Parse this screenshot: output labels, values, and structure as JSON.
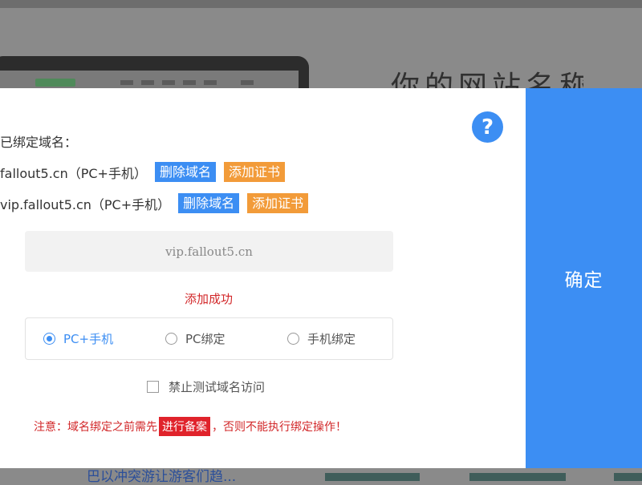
{
  "background_page": {
    "heading": "你的网站名称",
    "bottom_text": "巴以冲突游让游客们趋..."
  },
  "dialog": {
    "help_icon": "?",
    "bound_title": "已绑定域名：",
    "domains": [
      {
        "name": "fallout5.cn（PC+手机）",
        "delete_label": "删除域名",
        "cert_label": "添加证书"
      },
      {
        "name": "vip.fallout5.cn（PC+手机）",
        "delete_label": "删除域名",
        "cert_label": "添加证书"
      }
    ],
    "domain_input": {
      "value": "vip.fallout5.cn"
    },
    "success_message": "添加成功",
    "radios": [
      {
        "label": "PC+手机",
        "checked": true
      },
      {
        "label": "PC绑定",
        "checked": false
      },
      {
        "label": "手机绑定",
        "checked": false
      }
    ],
    "checkbox_label": "禁止测试域名访问",
    "notice": {
      "before": "注意：域名绑定之前需先",
      "highlight": "进行备案",
      "after": "，否则不能执行绑定操作！"
    }
  },
  "confirm_label": "确定",
  "colors": {
    "accent": "#3c8ef3",
    "orange": "#f29b39",
    "error": "#d2282a"
  }
}
